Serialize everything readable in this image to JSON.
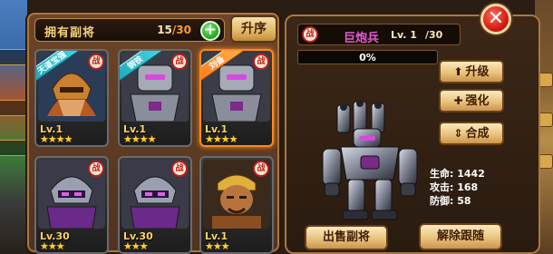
{
  "header": {
    "owned_label": "拥有副将",
    "owned_count": "15",
    "owned_max": "/30",
    "add_icon": "plus-icon",
    "sort_label": "升序"
  },
  "cards": [
    {
      "tag": "天道宝强",
      "tag_color": "#3fd3e4",
      "badge": "战",
      "level": "Lv.1",
      "stars": "★★★★",
      "selected": false,
      "portrait": "warrior-helmet"
    },
    {
      "tag": "钢铁",
      "tag_color": "#3fd3e4",
      "badge": "战",
      "level": "Lv.1",
      "stars": "★★★★",
      "selected": false,
      "portrait": "robot"
    },
    {
      "tag": "刘备",
      "tag_color": "#ffb04a",
      "badge": "战",
      "level": "Lv.1",
      "stars": "★★★★",
      "selected": true,
      "portrait": "robot"
    },
    {
      "tag": "",
      "badge": "战",
      "level": "Lv.30",
      "stars": "★★★",
      "selected": false,
      "portrait": "purple-ninja"
    },
    {
      "tag": "",
      "badge": "战",
      "level": "Lv.30",
      "stars": "★★★",
      "selected": false,
      "portrait": "purple-ninja"
    },
    {
      "tag": "",
      "badge": "战",
      "level": "Lv.1",
      "stars": "★★★",
      "selected": false,
      "portrait": "bandana-fighter"
    }
  ],
  "detail": {
    "badge": "战",
    "name": "巨炮兵",
    "level": "Lv. 1",
    "level_frac": "/30",
    "progress_text": "0%",
    "progress_value": 0,
    "upgrade_label": "升级",
    "enhance_label": "强化",
    "combine_label": "合成",
    "stats": [
      {
        "key": "生命:",
        "value": "1442"
      },
      {
        "key": "攻击:",
        "value": "168"
      },
      {
        "key": "防御:",
        "value": "58"
      }
    ],
    "sell_label": "出售副将",
    "unfollow_label": "解除跟随"
  },
  "close_icon": "close-icon"
}
